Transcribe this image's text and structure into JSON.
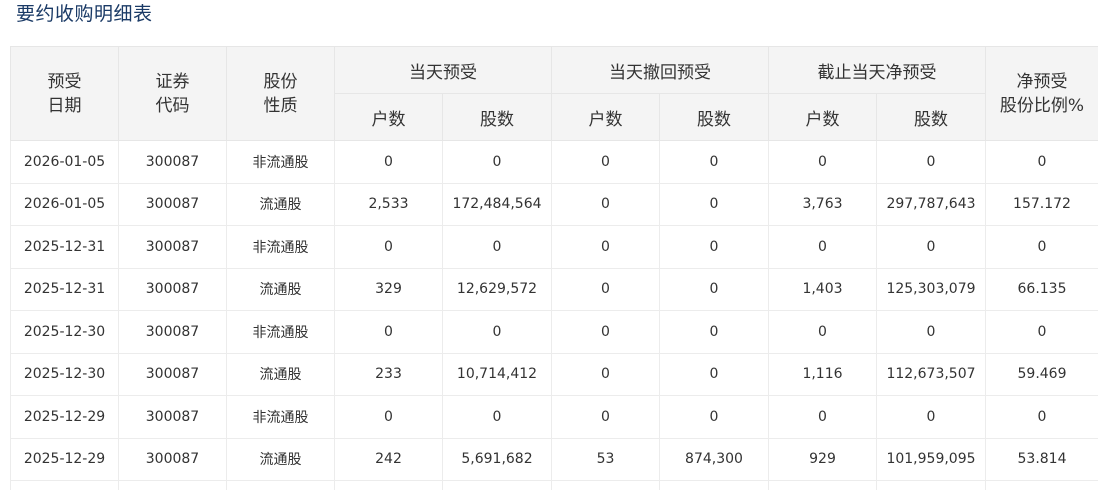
{
  "page_title": "要约收购明细表",
  "headers": {
    "date_line1": "预受",
    "date_line2": "日期",
    "code_line1": "证券",
    "code_line2": "代码",
    "nature_line1": "股份",
    "nature_line2": "性质",
    "group_today": "当天预受",
    "group_withdraw": "当天撤回预受",
    "group_net": "截止当天净预受",
    "ratio_line1": "净预受",
    "ratio_line2": "股份比例%",
    "accounts": "户数",
    "shares": "股数"
  },
  "rows": [
    {
      "date": "2026-01-05",
      "code": "300087",
      "nature": "非流通股",
      "today_accounts": "0",
      "today_shares": "0",
      "withdraw_accounts": "0",
      "withdraw_shares": "0",
      "net_accounts": "0",
      "net_shares": "0",
      "ratio": "0"
    },
    {
      "date": "2026-01-05",
      "code": "300087",
      "nature": "流通股",
      "today_accounts": "2,533",
      "today_shares": "172,484,564",
      "withdraw_accounts": "0",
      "withdraw_shares": "0",
      "net_accounts": "3,763",
      "net_shares": "297,787,643",
      "ratio": "157.172"
    },
    {
      "date": "2025-12-31",
      "code": "300087",
      "nature": "非流通股",
      "today_accounts": "0",
      "today_shares": "0",
      "withdraw_accounts": "0",
      "withdraw_shares": "0",
      "net_accounts": "0",
      "net_shares": "0",
      "ratio": "0"
    },
    {
      "date": "2025-12-31",
      "code": "300087",
      "nature": "流通股",
      "today_accounts": "329",
      "today_shares": "12,629,572",
      "withdraw_accounts": "0",
      "withdraw_shares": "0",
      "net_accounts": "1,403",
      "net_shares": "125,303,079",
      "ratio": "66.135"
    },
    {
      "date": "2025-12-30",
      "code": "300087",
      "nature": "非流通股",
      "today_accounts": "0",
      "today_shares": "0",
      "withdraw_accounts": "0",
      "withdraw_shares": "0",
      "net_accounts": "0",
      "net_shares": "0",
      "ratio": "0"
    },
    {
      "date": "2025-12-30",
      "code": "300087",
      "nature": "流通股",
      "today_accounts": "233",
      "today_shares": "10,714,412",
      "withdraw_accounts": "0",
      "withdraw_shares": "0",
      "net_accounts": "1,116",
      "net_shares": "112,673,507",
      "ratio": "59.469"
    },
    {
      "date": "2025-12-29",
      "code": "300087",
      "nature": "非流通股",
      "today_accounts": "0",
      "today_shares": "0",
      "withdraw_accounts": "0",
      "withdraw_shares": "0",
      "net_accounts": "0",
      "net_shares": "0",
      "ratio": "0"
    },
    {
      "date": "2025-12-29",
      "code": "300087",
      "nature": "流通股",
      "today_accounts": "242",
      "today_shares": "5,691,682",
      "withdraw_accounts": "53",
      "withdraw_shares": "874,300",
      "net_accounts": "929",
      "net_shares": "101,959,095",
      "ratio": "53.814"
    }
  ]
}
